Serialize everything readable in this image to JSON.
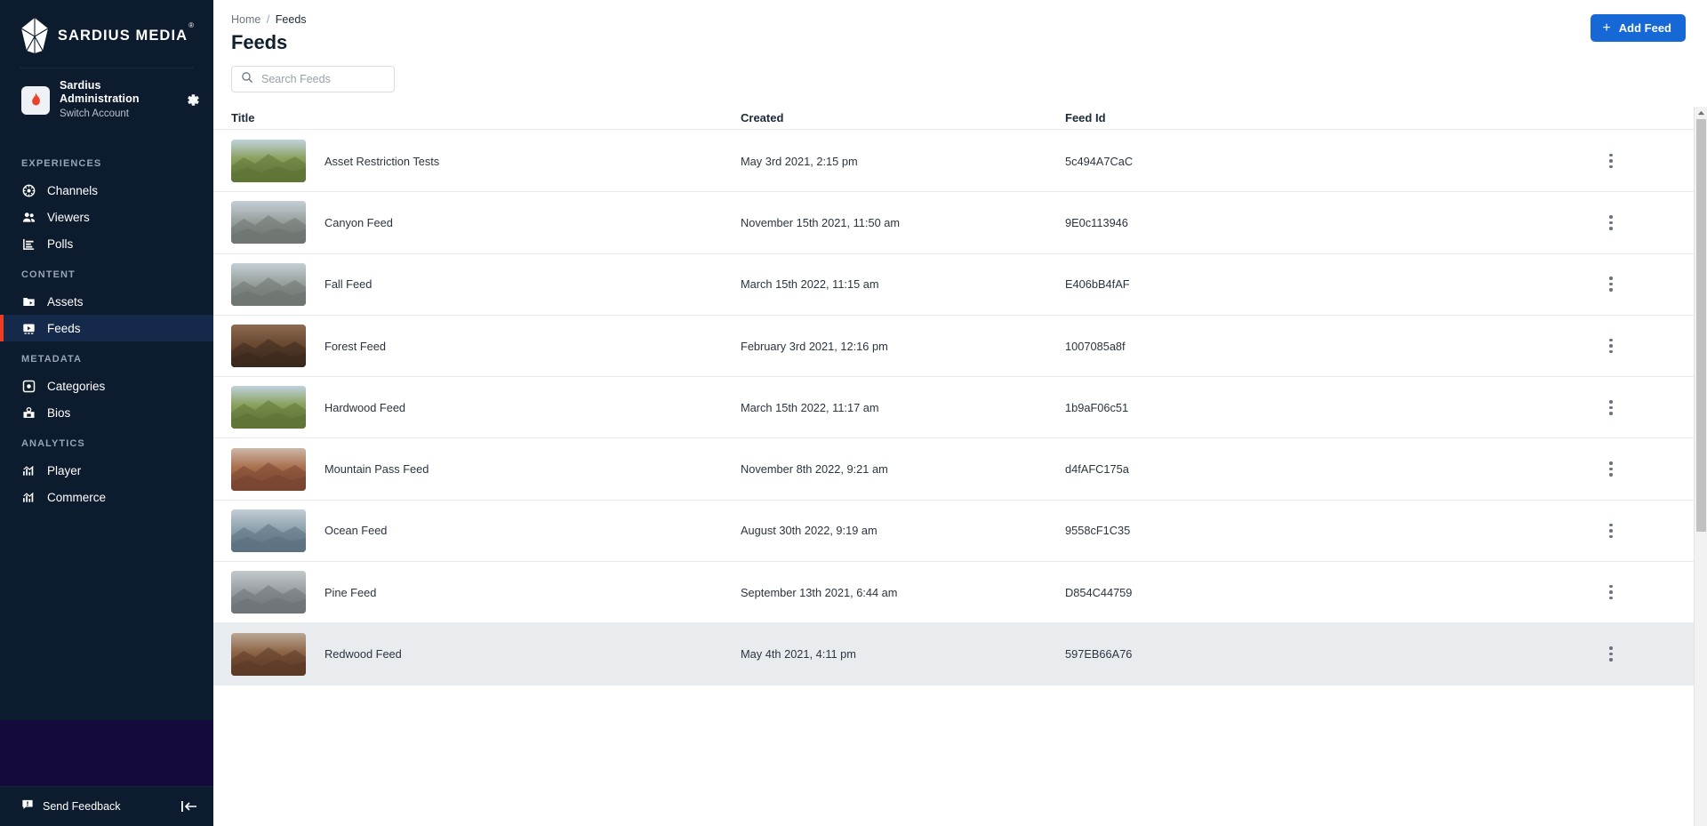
{
  "brand": {
    "name": "SARDIUS MEDIA",
    "trademark": "®",
    "logo_icon": "gem-leaf-logo"
  },
  "account": {
    "name": "Sardius Administration",
    "switch_label": "Switch Account",
    "avatar_icon": "flame-avatar",
    "settings_icon": "gear-icon"
  },
  "sidebar": {
    "groups": [
      {
        "label": "EXPERIENCES",
        "items": [
          {
            "label": "Channels",
            "icon": "globe-icon",
            "active": false
          },
          {
            "label": "Viewers",
            "icon": "people-icon",
            "active": false
          },
          {
            "label": "Polls",
            "icon": "bar-chart-icon",
            "active": false
          }
        ]
      },
      {
        "label": "CONTENT",
        "items": [
          {
            "label": "Assets",
            "icon": "folder-video-icon",
            "active": false
          },
          {
            "label": "Feeds",
            "icon": "video-box-icon",
            "active": true
          }
        ]
      },
      {
        "label": "METADATA",
        "items": [
          {
            "label": "Categories",
            "icon": "category-icon",
            "active": false
          },
          {
            "label": "Bios",
            "icon": "bio-card-icon",
            "active": false
          }
        ]
      },
      {
        "label": "ANALYTICS",
        "items": [
          {
            "label": "Player",
            "icon": "analytics-chart-icon",
            "active": false
          },
          {
            "label": "Commerce",
            "icon": "analytics-chart-icon",
            "active": false
          }
        ]
      }
    ],
    "footer": {
      "feedback_label": "Send Feedback",
      "feedback_icon": "chat-feedback-icon",
      "collapse_icon": "collapse-sidebar-icon"
    }
  },
  "header": {
    "breadcrumb": {
      "home": "Home",
      "separator": "/",
      "current": "Feeds"
    },
    "title": "Feeds",
    "add_button": {
      "label": "Add Feed",
      "icon": "plus-icon"
    }
  },
  "search": {
    "placeholder": "Search Feeds",
    "value": "",
    "icon": "search-icon"
  },
  "table": {
    "columns": [
      {
        "key": "title",
        "label": "Title"
      },
      {
        "key": "created",
        "label": "Created"
      },
      {
        "key": "feed_id",
        "label": "Feed Id"
      }
    ],
    "row_menu_icon": "kebab-menu-icon",
    "rows": [
      {
        "title": "Asset Restriction Tests",
        "created": "May 3rd 2021, 2:15 pm",
        "feed_id": "5c494A7CaC",
        "thumbnail": "forest-hillside-green",
        "hover": false
      },
      {
        "title": "Canyon Feed",
        "created": "November 15th 2021, 11:50 am",
        "feed_id": "9E0c113946",
        "thumbnail": "burned-forest-ridge",
        "hover": false
      },
      {
        "title": "Fall Feed",
        "created": "March 15th 2022, 11:15 am",
        "feed_id": "E406bB4fAF",
        "thumbnail": "burned-forest-ridge",
        "hover": false
      },
      {
        "title": "Forest Feed",
        "created": "February 3rd 2021, 12:16 pm",
        "feed_id": "1007085a8f",
        "thumbnail": "fallen-log-closeup",
        "hover": false
      },
      {
        "title": "Hardwood Feed",
        "created": "March 15th 2022, 11:17 am",
        "feed_id": "1b9aF06c51",
        "thumbnail": "forest-hillside-green",
        "hover": false
      },
      {
        "title": "Mountain Pass Feed",
        "created": "November 8th 2022, 9:21 am",
        "feed_id": "d4fAFC175a",
        "thumbnail": "canyon-rock-person",
        "hover": false
      },
      {
        "title": "Ocean Feed",
        "created": "August 30th 2022, 9:19 am",
        "feed_id": "9558cF1C35",
        "thumbnail": "ocean-coast-waves",
        "hover": false
      },
      {
        "title": "Pine Feed",
        "created": "September 13th 2021, 6:44 am",
        "feed_id": "D854C44759",
        "thumbnail": "rock-slope-texture",
        "hover": false
      },
      {
        "title": "Redwood Feed",
        "created": "May 4th 2021, 4:11 pm",
        "feed_id": "597EB66A76",
        "thumbnail": "redwood-trunk-person",
        "hover": true
      }
    ]
  },
  "scrollbar": {
    "up_arrow_icon": "scroll-up-arrow-icon",
    "thumb_icon": "scrollbar-thumb"
  },
  "colors": {
    "sidebar_bg": "#0d1b2e",
    "sidebar_active_bg": "#15294a",
    "active_accent": "#ef3c24",
    "primary_button": "#1668d6",
    "promo_block": "#150a3c",
    "row_hover": "#e9ecef"
  }
}
